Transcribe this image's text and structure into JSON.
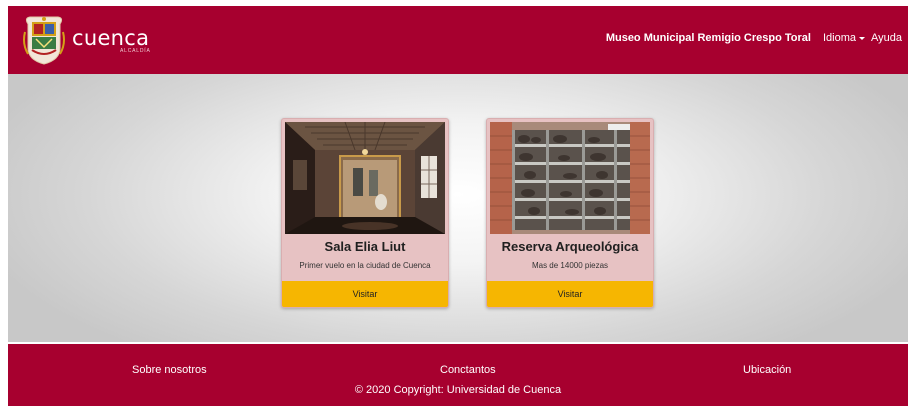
{
  "brand": {
    "logo_icon": "coat-of-arms-icon",
    "name": "cuenca",
    "subtitle": "ALCALDÍA"
  },
  "nav": {
    "museum": "Museo Municipal Remigio Crespo Toral",
    "language": "Idioma",
    "help": "Ayuda"
  },
  "cards": [
    {
      "title": "Sala Elia Liut",
      "description": "Primer vuelo en la ciudad de Cuenca",
      "button": "Visitar",
      "image_icon": "exhibition-room-photo"
    },
    {
      "title": "Reserva Arqueológica",
      "description": "Mas de 14000 piezas",
      "button": "Visitar",
      "image_icon": "archaeological-storage-photo"
    }
  ],
  "footer": {
    "about": "Sobre nosotros",
    "contacts": "Conctantos",
    "location": "Ubicación",
    "copyright": "© 2020 Copyright: Universidad de Cuenca"
  },
  "colors": {
    "brand_red": "#a7002f",
    "card_bg": "#e7c2c3",
    "button_yellow": "#f6b601"
  }
}
